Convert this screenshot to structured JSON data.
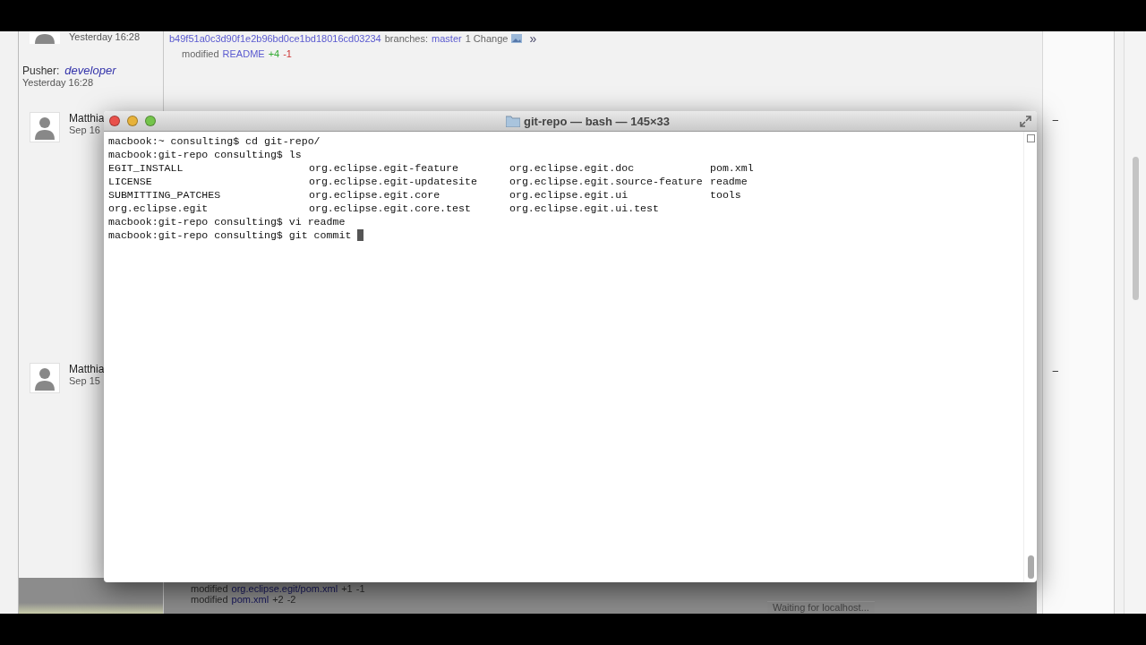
{
  "browser_page": {
    "entries": [
      {
        "kind": "push",
        "time": "Yesterday 16:28",
        "commit": {
          "hash": "b49f51a0c3d90f1e2b96bd0ce1bd18016cd03234",
          "branches_label": "branches:",
          "branch": "master",
          "changes": "1 Change",
          "more": "»"
        },
        "files": [
          {
            "action": "modified",
            "path": "README",
            "added": "+4",
            "removed": "-1"
          }
        ],
        "pusher_label": "Pusher:",
        "pusher": "developer",
        "push_time": "Yesterday 16:28"
      },
      {
        "kind": "collapsed",
        "author": "Matthia",
        "date": "Sep 16",
        "collapse": "−"
      },
      {
        "kind": "collapsed",
        "author": "Matthia",
        "date": "Sep 15",
        "collapse": "−",
        "files": [
          {
            "action": "modified",
            "path": "org.eclipse.egit/pom.xml",
            "added": "+1",
            "removed": "-1"
          },
          {
            "action": "modified",
            "path": "pom.xml",
            "added": "+2",
            "removed": "-2"
          }
        ]
      }
    ],
    "status": "Waiting for localhost..."
  },
  "terminal": {
    "title": "git-repo — bash — 145×33",
    "lines": [
      {
        "kind": "command",
        "text": "macbook:~ consulting$ cd git-repo/"
      },
      {
        "kind": "command",
        "text": "macbook:git-repo consulting$ ls"
      },
      {
        "kind": "listing",
        "cells": [
          "EGIT_INSTALL",
          "org.eclipse.egit-feature",
          "org.eclipse.egit.doc",
          "pom.xml"
        ]
      },
      {
        "kind": "listing",
        "cells": [
          "LICENSE",
          "org.eclipse.egit-updatesite",
          "org.eclipse.egit.source-feature",
          "readme"
        ]
      },
      {
        "kind": "listing",
        "cells": [
          "SUBMITTING_PATCHES",
          "org.eclipse.egit.core",
          "org.eclipse.egit.ui",
          "tools"
        ]
      },
      {
        "kind": "listing",
        "cells": [
          "org.eclipse.egit",
          "org.eclipse.egit.core.test",
          "org.eclipse.egit.ui.test"
        ]
      },
      {
        "kind": "command",
        "text": "macbook:git-repo consulting$ vi readme"
      },
      {
        "kind": "command",
        "text": "macbook:git-repo consulting$ git commit",
        "cursor": true
      }
    ]
  }
}
